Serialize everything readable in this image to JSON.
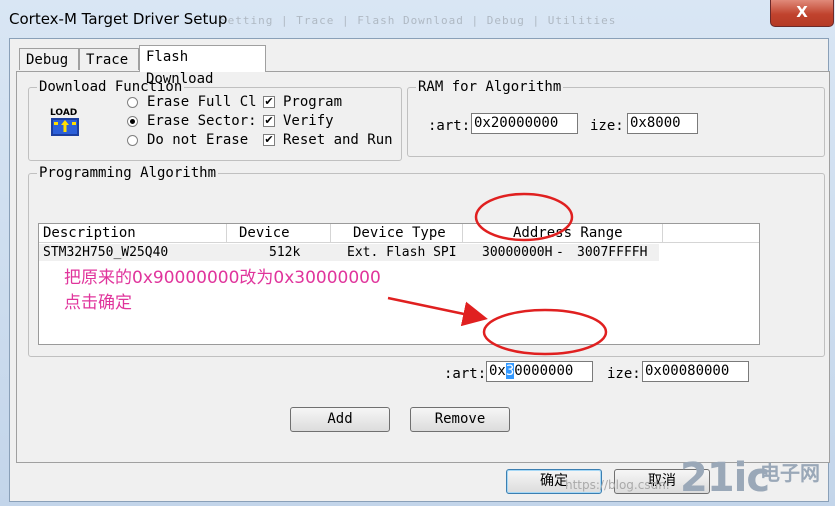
{
  "window": {
    "title": "Cortex-M Target Driver Setup",
    "close_label": "X",
    "background_tabs_faded": "Setting | Trace | Flash Download | Debug | Utilities"
  },
  "tabs": [
    {
      "label": "Debug"
    },
    {
      "label": "Trace"
    },
    {
      "label": "Flash Download"
    }
  ],
  "download_function": {
    "title": "Download Function",
    "icon_label": "LOAD",
    "radios": [
      {
        "label": "Erase Full Cl",
        "selected": false
      },
      {
        "label": "Erase Sector:",
        "selected": true
      },
      {
        "label": "Do not Erase",
        "selected": false
      }
    ],
    "checks": [
      {
        "label": "Program",
        "checked": true
      },
      {
        "label": "Verify",
        "checked": true
      },
      {
        "label": "Reset and Run",
        "checked": true
      }
    ],
    "check_mark": "✔"
  },
  "ram_algorithm": {
    "title": "RAM for Algorithm",
    "start_label": ":art:",
    "start_value": "0x20000000",
    "size_label": "ize:",
    "size_value": "0x8000"
  },
  "programming_algorithm": {
    "title": "Programming Algorithm",
    "columns": [
      "Description",
      "Device Size",
      "Device Type",
      "Address Range"
    ],
    "rows": [
      {
        "description": "STM32H750_W25Q40",
        "device_size": "512k",
        "device_type": "Ext. Flash SPI",
        "range_start": "30000000H",
        "range_sep": " - ",
        "range_end": "3007FFFFH"
      }
    ],
    "start_label": ":art:",
    "start_prefix": "0x",
    "start_selected": "3",
    "start_rest": "0000000",
    "size_label": "ize:",
    "size_value": "0x00080000"
  },
  "buttons": {
    "add": "Add",
    "remove": "Remove",
    "ok": "确定",
    "cancel": "取消"
  },
  "annotation": {
    "line1": "把原来的0x90000000改为0x30000000",
    "line2": "点击确定",
    "color": "#e0359c",
    "circle_color": "#e02020"
  },
  "watermark": {
    "url": "https://blog.csdn.",
    "logo_main": "21ic",
    "logo_cn": "电子网"
  }
}
